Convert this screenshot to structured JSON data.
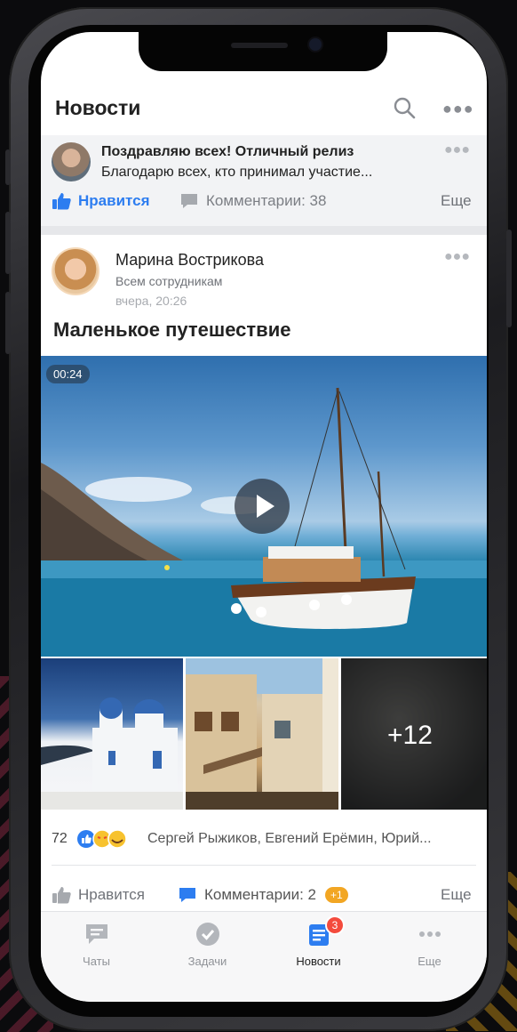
{
  "header": {
    "title": "Новости"
  },
  "post1": {
    "title": "Поздравляю всех! Отличный релиз",
    "text": "Благодарю всех, кто принимал участие...",
    "like_label": "Нравится",
    "comments_label": "Комментарии: 38",
    "more_label": "Еще"
  },
  "post2": {
    "author": "Марина Вострикова",
    "audience": "Всем сотрудникам",
    "time": "вчера, 20:26",
    "title": "Маленькое путешествие",
    "video_duration": "00:24",
    "more_photos": "+12",
    "reactions_count": "72",
    "reactors": "Сергей Рыжиков, Евгений Ерёмин, Юрий...",
    "like_label": "Нравится",
    "comments_label": "Комментарии: 2",
    "new_comments_badge": "+1",
    "more_label": "Еще"
  },
  "tabbar": {
    "items": [
      {
        "label": "Чаты",
        "icon": "chat-icon"
      },
      {
        "label": "Задачи",
        "icon": "check-icon"
      },
      {
        "label": "Новости",
        "icon": "news-icon",
        "badge": "3"
      },
      {
        "label": "Еще",
        "icon": "more-dots-icon"
      }
    ],
    "active": "Новости"
  },
  "colors": {
    "accent": "#2d7df0",
    "badge": "#f44b3d",
    "new_badge": "#f2a623"
  }
}
